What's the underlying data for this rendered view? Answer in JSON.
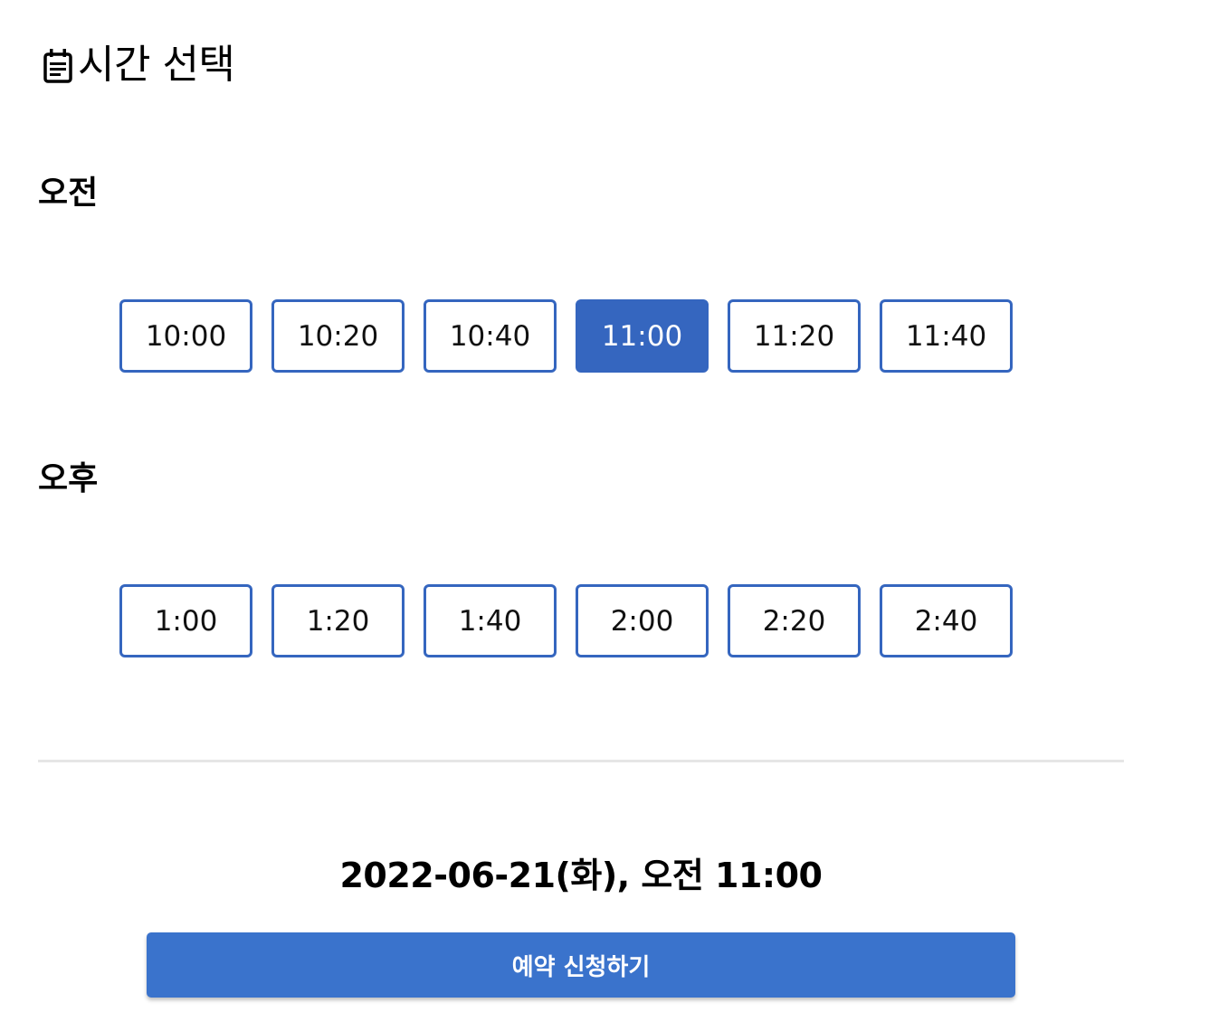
{
  "header": {
    "title": "시간 선택",
    "icon": "calendar-icon"
  },
  "am": {
    "label": "오전",
    "slots": [
      "10:00",
      "10:20",
      "10:40",
      "11:00",
      "11:20",
      "11:40"
    ],
    "selected": "11:00"
  },
  "pm": {
    "label": "오후",
    "slots": [
      "1:00",
      "1:20",
      "1:40",
      "2:00",
      "2:20",
      "2:40"
    ],
    "selected": null
  },
  "summary": {
    "text": "2022-06-21(화), 오전 11:00"
  },
  "submit": {
    "label": "예약 신청하기"
  },
  "colors": {
    "accent": "#3566bf",
    "button": "#3a73cc",
    "divider": "#e6e6e6"
  }
}
